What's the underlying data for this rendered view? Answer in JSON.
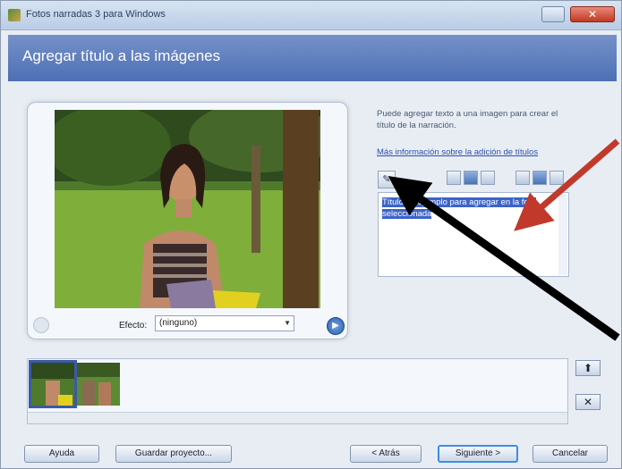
{
  "window": {
    "title": "Fotos narradas 3 para Windows",
    "close_glyph": "✕"
  },
  "header": {
    "title": "Agregar título a las imágenes"
  },
  "preview": {
    "effect_label": "Efecto:",
    "effect_value": "(ninguno)",
    "next_icon": "arrow-right-icon",
    "prev_icon": "arrow-left-icon"
  },
  "caption_panel": {
    "info_text": "Puede agregar texto a una imagen para crear el título de la narración.",
    "more_info_link": "Más información sobre la adición de títulos",
    "font_button_icon": "pencil-icon",
    "selected_text": "Título de ejemplo para agregar en la foto seleccionada"
  },
  "filmstrip": {
    "up_glyph": "⬆",
    "remove_glyph": "✕"
  },
  "buttons": {
    "help": "Ayuda",
    "save_project": "Guardar proyecto...",
    "back": "< Atrás",
    "next": "Siguiente >",
    "cancel": "Cancelar"
  },
  "colors": {
    "header": "#4d6fb4",
    "annotation_red": "#c0392b",
    "annotation_black": "#000000"
  }
}
